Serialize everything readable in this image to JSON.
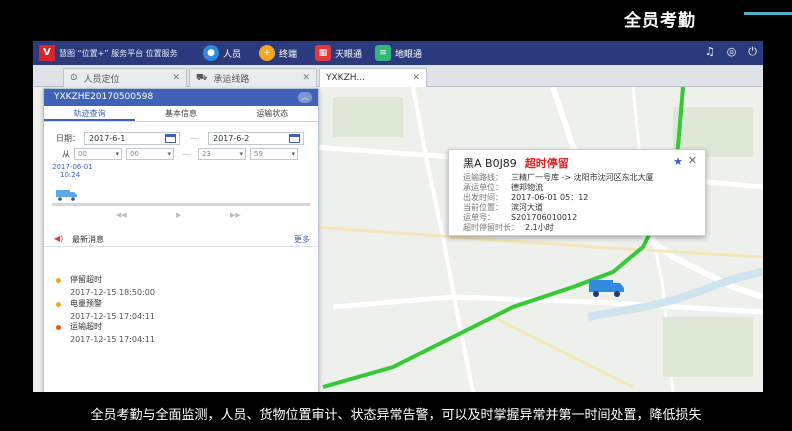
{
  "slide": {
    "title": "全员考勤",
    "caption": "全员考勤与全面监测，人员、货物位置审计、状态异常告警，可以及时掌握异常并第一时间处置，降低损失"
  },
  "topbar": {
    "logo_text": "V",
    "platform_name": "慧图 “位置+” 服务平台  位置服务",
    "nav": [
      {
        "label": "人员",
        "icon": "person-icon",
        "color": "#2f8ae0"
      },
      {
        "label": "终端",
        "icon": "plus-icon",
        "color": "#f5a623"
      },
      {
        "label": "天眼通",
        "icon": "chart-icon",
        "color": "#e23a3a"
      },
      {
        "label": "地眼通",
        "icon": "list-icon",
        "color": "#2fb87a"
      }
    ]
  },
  "tabs": [
    {
      "label": "人员定位",
      "active": false
    },
    {
      "label": "承运线路",
      "active": false
    },
    {
      "label": "YXKZH...",
      "active": true
    }
  ],
  "panel": {
    "title": "YXKZHE20170500598",
    "tabs": [
      "轨迹查询",
      "基本信息",
      "运输状态"
    ],
    "date_label": "日期：",
    "date_from": "2017-6-1",
    "date_to": "2017-6-2",
    "time_label": "从",
    "time_from_h": "00",
    "time_from_m": "00",
    "time_to_h": "23",
    "time_to_m": "59",
    "track_date": "2017-06-01",
    "track_time": "10:24",
    "messages_title": "最新消息",
    "more_label": "更多",
    "messages": [
      {
        "title": "停留超时",
        "time": "2017-12-15 18:50:00",
        "color": "#f5a623"
      },
      {
        "title": "电量预警",
        "time": "2017-12-15 17:04:11",
        "color": "#f5a623"
      },
      {
        "title": "运输超时",
        "time": "2017-12-15 17:04:11",
        "color": "#e8541c"
      }
    ]
  },
  "popup": {
    "plate": "黑A B0J89",
    "alert": "超时停留",
    "rows": [
      {
        "k": "运输路线：",
        "v": "三精厂一号库 -> 沈阳市沈河区东北大厦"
      },
      {
        "k": "承运单位：",
        "v": "德邦物流"
      },
      {
        "k": "出发时间：",
        "v": "2017-06-01 05：12"
      },
      {
        "k": "当前位置：",
        "v": "滨河大道"
      },
      {
        "k": "运单号：",
        "v": "S201706010012"
      },
      {
        "k": "超时停留时长：",
        "v": "2.1小时"
      }
    ]
  },
  "colors": {
    "route_green": "#35c935",
    "brand_blue": "#3f62b8",
    "alert_red": "#e02020"
  }
}
